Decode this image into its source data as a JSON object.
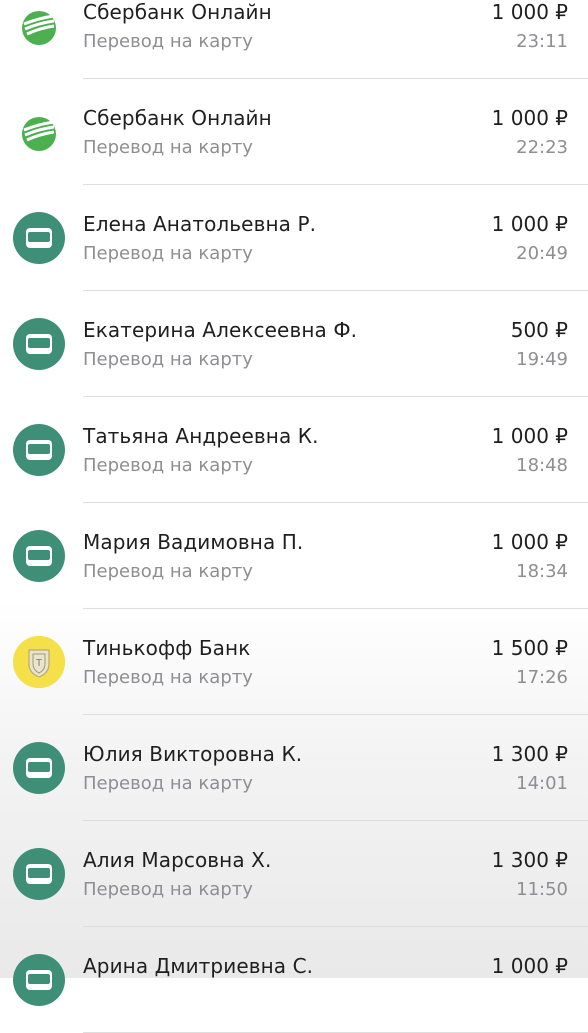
{
  "transactions": [
    {
      "icon": "sberbank-logo-icon",
      "name": "Сбербанк Онлайн",
      "subtitle": "Перевод на карту",
      "amount": "1 000 ₽",
      "time": "23:11"
    },
    {
      "icon": "sberbank-logo-icon",
      "name": "Сбербанк Онлайн",
      "subtitle": "Перевод на карту",
      "amount": "1 000 ₽",
      "time": "22:23"
    },
    {
      "icon": "card-icon",
      "name": "Елена Анатольевна Р.",
      "subtitle": "Перевод на карту",
      "amount": "1 000 ₽",
      "time": "20:49"
    },
    {
      "icon": "card-icon",
      "name": "Екатерина Алексеевна Ф.",
      "subtitle": "Перевод на карту",
      "amount": "500 ₽",
      "time": "19:49"
    },
    {
      "icon": "card-icon",
      "name": "Татьяна Андреевна К.",
      "subtitle": "Перевод на карту",
      "amount": "1 000 ₽",
      "time": "18:48"
    },
    {
      "icon": "card-icon",
      "name": "Мария Вадимовна П.",
      "subtitle": "Перевод на карту",
      "amount": "1 000 ₽",
      "time": "18:34"
    },
    {
      "icon": "tinkoff-logo-icon",
      "name": "Тинькофф Банк",
      "subtitle": "Перевод на карту",
      "amount": "1 500 ₽",
      "time": "17:26"
    },
    {
      "icon": "card-icon",
      "name": "Юлия Викторовна К.",
      "subtitle": "Перевод на карту",
      "amount": "1 300 ₽",
      "time": "14:01"
    },
    {
      "icon": "card-icon",
      "name": "Алия Марсовна Х.",
      "subtitle": "Перевод на карту",
      "amount": "1 300 ₽",
      "time": "11:50"
    },
    {
      "icon": "card-icon",
      "name": "Арина Дмитриевна С.",
      "subtitle": "",
      "amount": "1 000 ₽",
      "time": ""
    }
  ],
  "colors": {
    "card_icon_bg": "#3f8f76",
    "sber_green": "#4caf50",
    "tinkoff_yellow": "#f5e04a"
  }
}
